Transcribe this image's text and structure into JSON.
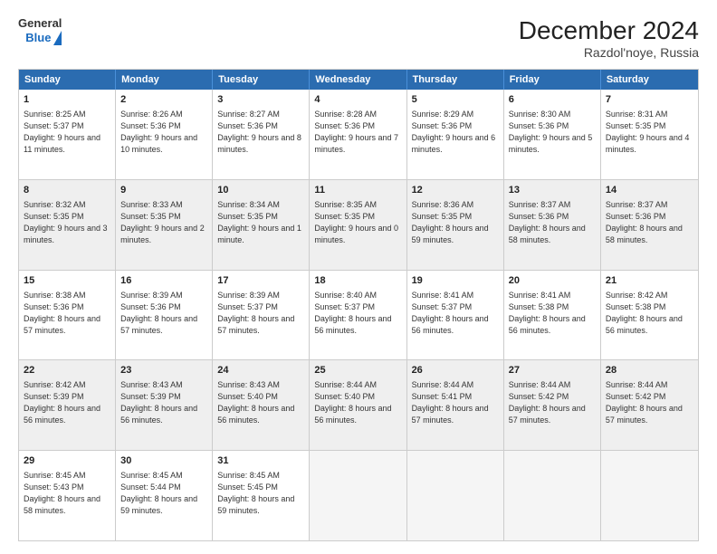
{
  "logo": {
    "general": "General",
    "blue": "Blue"
  },
  "title": "December 2024",
  "subtitle": "Razdol'noye, Russia",
  "days": [
    "Sunday",
    "Monday",
    "Tuesday",
    "Wednesday",
    "Thursday",
    "Friday",
    "Saturday"
  ],
  "weeks": [
    [
      {
        "day": "1",
        "sunrise": "8:25 AM",
        "sunset": "5:37 PM",
        "daylight": "9 hours and 11 minutes."
      },
      {
        "day": "2",
        "sunrise": "8:26 AM",
        "sunset": "5:36 PM",
        "daylight": "9 hours and 10 minutes."
      },
      {
        "day": "3",
        "sunrise": "8:27 AM",
        "sunset": "5:36 PM",
        "daylight": "9 hours and 8 minutes."
      },
      {
        "day": "4",
        "sunrise": "8:28 AM",
        "sunset": "5:36 PM",
        "daylight": "9 hours and 7 minutes."
      },
      {
        "day": "5",
        "sunrise": "8:29 AM",
        "sunset": "5:36 PM",
        "daylight": "9 hours and 6 minutes."
      },
      {
        "day": "6",
        "sunrise": "8:30 AM",
        "sunset": "5:36 PM",
        "daylight": "9 hours and 5 minutes."
      },
      {
        "day": "7",
        "sunrise": "8:31 AM",
        "sunset": "5:35 PM",
        "daylight": "9 hours and 4 minutes."
      }
    ],
    [
      {
        "day": "8",
        "sunrise": "8:32 AM",
        "sunset": "5:35 PM",
        "daylight": "9 hours and 3 minutes."
      },
      {
        "day": "9",
        "sunrise": "8:33 AM",
        "sunset": "5:35 PM",
        "daylight": "9 hours and 2 minutes."
      },
      {
        "day": "10",
        "sunrise": "8:34 AM",
        "sunset": "5:35 PM",
        "daylight": "9 hours and 1 minute."
      },
      {
        "day": "11",
        "sunrise": "8:35 AM",
        "sunset": "5:35 PM",
        "daylight": "9 hours and 0 minutes."
      },
      {
        "day": "12",
        "sunrise": "8:36 AM",
        "sunset": "5:35 PM",
        "daylight": "8 hours and 59 minutes."
      },
      {
        "day": "13",
        "sunrise": "8:37 AM",
        "sunset": "5:36 PM",
        "daylight": "8 hours and 58 minutes."
      },
      {
        "day": "14",
        "sunrise": "8:37 AM",
        "sunset": "5:36 PM",
        "daylight": "8 hours and 58 minutes."
      }
    ],
    [
      {
        "day": "15",
        "sunrise": "8:38 AM",
        "sunset": "5:36 PM",
        "daylight": "8 hours and 57 minutes."
      },
      {
        "day": "16",
        "sunrise": "8:39 AM",
        "sunset": "5:36 PM",
        "daylight": "8 hours and 57 minutes."
      },
      {
        "day": "17",
        "sunrise": "8:39 AM",
        "sunset": "5:37 PM",
        "daylight": "8 hours and 57 minutes."
      },
      {
        "day": "18",
        "sunrise": "8:40 AM",
        "sunset": "5:37 PM",
        "daylight": "8 hours and 56 minutes."
      },
      {
        "day": "19",
        "sunrise": "8:41 AM",
        "sunset": "5:37 PM",
        "daylight": "8 hours and 56 minutes."
      },
      {
        "day": "20",
        "sunrise": "8:41 AM",
        "sunset": "5:38 PM",
        "daylight": "8 hours and 56 minutes."
      },
      {
        "day": "21",
        "sunrise": "8:42 AM",
        "sunset": "5:38 PM",
        "daylight": "8 hours and 56 minutes."
      }
    ],
    [
      {
        "day": "22",
        "sunrise": "8:42 AM",
        "sunset": "5:39 PM",
        "daylight": "8 hours and 56 minutes."
      },
      {
        "day": "23",
        "sunrise": "8:43 AM",
        "sunset": "5:39 PM",
        "daylight": "8 hours and 56 minutes."
      },
      {
        "day": "24",
        "sunrise": "8:43 AM",
        "sunset": "5:40 PM",
        "daylight": "8 hours and 56 minutes."
      },
      {
        "day": "25",
        "sunrise": "8:44 AM",
        "sunset": "5:40 PM",
        "daylight": "8 hours and 56 minutes."
      },
      {
        "day": "26",
        "sunrise": "8:44 AM",
        "sunset": "5:41 PM",
        "daylight": "8 hours and 57 minutes."
      },
      {
        "day": "27",
        "sunrise": "8:44 AM",
        "sunset": "5:42 PM",
        "daylight": "8 hours and 57 minutes."
      },
      {
        "day": "28",
        "sunrise": "8:44 AM",
        "sunset": "5:42 PM",
        "daylight": "8 hours and 57 minutes."
      }
    ],
    [
      {
        "day": "29",
        "sunrise": "8:45 AM",
        "sunset": "5:43 PM",
        "daylight": "8 hours and 58 minutes."
      },
      {
        "day": "30",
        "sunrise": "8:45 AM",
        "sunset": "5:44 PM",
        "daylight": "8 hours and 59 minutes."
      },
      {
        "day": "31",
        "sunrise": "8:45 AM",
        "sunset": "5:45 PM",
        "daylight": "8 hours and 59 minutes."
      },
      null,
      null,
      null,
      null
    ]
  ],
  "labels": {
    "sunrise": "Sunrise:",
    "sunset": "Sunset:",
    "daylight": "Daylight:"
  }
}
